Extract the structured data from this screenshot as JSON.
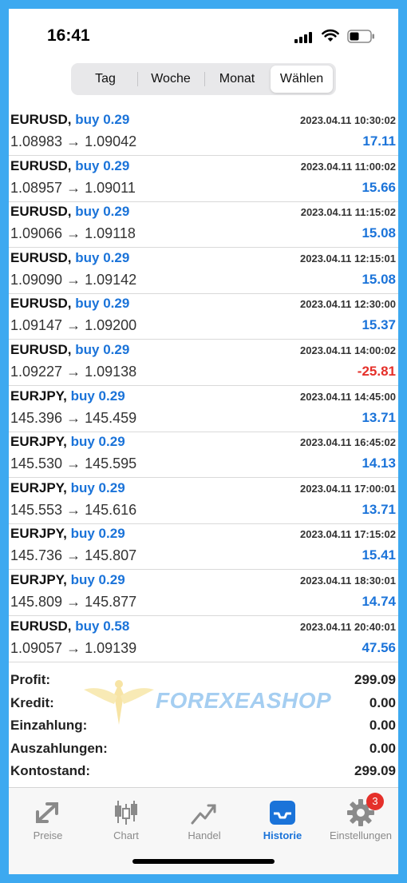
{
  "status": {
    "time": "16:41"
  },
  "segments": [
    "Tag",
    "Woche",
    "Monat",
    "Wählen"
  ],
  "selected_segment": "Wählen",
  "trades": [
    {
      "symbol": "EURUSD,",
      "side": "buy 0.29",
      "open": "1.08983",
      "close": "1.09042",
      "datetime": "2023.04.11 10:30:02",
      "profit": "17.11"
    },
    {
      "symbol": "EURUSD,",
      "side": "buy 0.29",
      "open": "1.08957",
      "close": "1.09011",
      "datetime": "2023.04.11 11:00:02",
      "profit": "15.66"
    },
    {
      "symbol": "EURUSD,",
      "side": "buy 0.29",
      "open": "1.09066",
      "close": "1.09118",
      "datetime": "2023.04.11 11:15:02",
      "profit": "15.08"
    },
    {
      "symbol": "EURUSD,",
      "side": "buy 0.29",
      "open": "1.09090",
      "close": "1.09142",
      "datetime": "2023.04.11 12:15:01",
      "profit": "15.08"
    },
    {
      "symbol": "EURUSD,",
      "side": "buy 0.29",
      "open": "1.09147",
      "close": "1.09200",
      "datetime": "2023.04.11 12:30:00",
      "profit": "15.37"
    },
    {
      "symbol": "EURUSD,",
      "side": "buy 0.29",
      "open": "1.09227",
      "close": "1.09138",
      "datetime": "2023.04.11 14:00:02",
      "profit": "-25.81"
    },
    {
      "symbol": "EURJPY,",
      "side": "buy 0.29",
      "open": "145.396",
      "close": "145.459",
      "datetime": "2023.04.11 14:45:00",
      "profit": "13.71"
    },
    {
      "symbol": "EURJPY,",
      "side": "buy 0.29",
      "open": "145.530",
      "close": "145.595",
      "datetime": "2023.04.11 16:45:02",
      "profit": "14.13"
    },
    {
      "symbol": "EURJPY,",
      "side": "buy 0.29",
      "open": "145.553",
      "close": "145.616",
      "datetime": "2023.04.11 17:00:01",
      "profit": "13.71"
    },
    {
      "symbol": "EURJPY,",
      "side": "buy 0.29",
      "open": "145.736",
      "close": "145.807",
      "datetime": "2023.04.11 17:15:02",
      "profit": "15.41"
    },
    {
      "symbol": "EURJPY,",
      "side": "buy 0.29",
      "open": "145.809",
      "close": "145.877",
      "datetime": "2023.04.11 18:30:01",
      "profit": "14.74"
    },
    {
      "symbol": "EURUSD,",
      "side": "buy 0.58",
      "open": "1.09057",
      "close": "1.09139",
      "datetime": "2023.04.11 20:40:01",
      "profit": "47.56"
    }
  ],
  "summary": [
    {
      "label": "Profit:",
      "value": "299.09"
    },
    {
      "label": "Kredit:",
      "value": "0.00"
    },
    {
      "label": "Einzahlung:",
      "value": "0.00"
    },
    {
      "label": "Auszahlungen:",
      "value": "0.00"
    },
    {
      "label": "Kontostand:",
      "value": "299.09"
    }
  ],
  "watermark": {
    "text": "FOREXEASHOP"
  },
  "tabs": [
    {
      "label": "Preise",
      "icon": "quotes-arrow-icon"
    },
    {
      "label": "Chart",
      "icon": "candlestick-icon"
    },
    {
      "label": "Handel",
      "icon": "trade-chart-icon"
    },
    {
      "label": "Historie",
      "icon": "inbox-tray-icon",
      "active": true
    },
    {
      "label": "Einstellungen",
      "icon": "gear-icon",
      "badge": "3"
    }
  ],
  "colors": {
    "accent": "#1a73d9",
    "negative": "#e5302a",
    "frame": "#3da9f0"
  }
}
